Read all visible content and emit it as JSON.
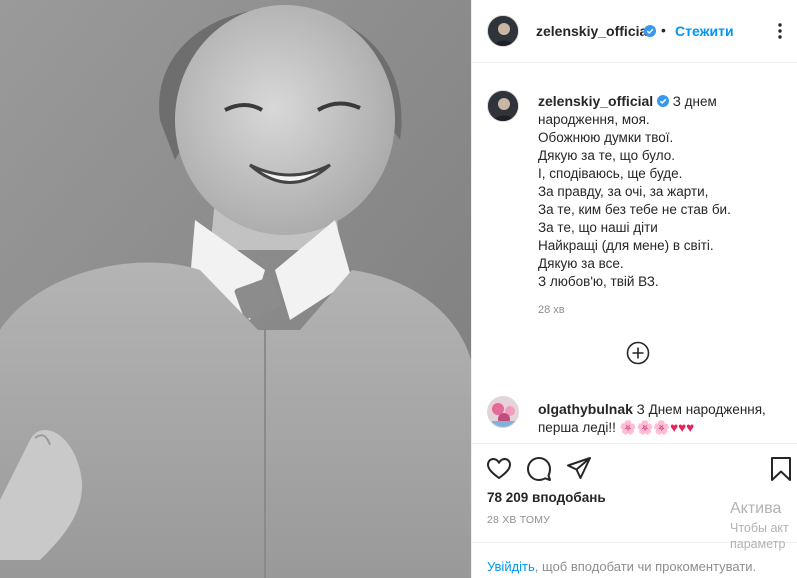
{
  "post": {
    "author": "zelenskiy_official",
    "follow_label": "Стежити",
    "separator": "•",
    "caption_lines": [
      "З днем",
      "народження, моя.",
      "Обожнюю думки твої.",
      "Дякую за те, що було.",
      "І, сподіваюсь, ще буде.",
      "За правду, за очі, за жарти,",
      "За те, ким без тебе не став би.",
      "За те, що наші діти",
      "Найкращі (для мене) в світі.",
      "Дякую за все.",
      "З любов'ю, твій ВЗ."
    ],
    "caption_time": "28 хв",
    "likes": "78 209 вподобань",
    "time_ago": "28 ХВ ТОМУ"
  },
  "comment": {
    "author": "olgathybulnak",
    "text": "З Днем народження, перша леді!!",
    "flowers": "🌸🌸🌸",
    "hearts": "♥♥♥"
  },
  "login_bar": {
    "link": "Увійдіть",
    "rest": ", щоб вподобати чи прокоментувати."
  },
  "watermark": {
    "title": "Актива",
    "line1": "Чтобы акт",
    "line2": "параметр"
  },
  "icons": {
    "verified": "verified-badge-icon",
    "more": "more-options-icon",
    "load_more": "plus-circle-icon",
    "like": "heart-icon",
    "comment": "comment-bubble-icon",
    "share": "paper-plane-icon",
    "save": "bookmark-icon"
  },
  "colors": {
    "accent": "#0095f6",
    "verified": "#3897f0",
    "text": "#262626",
    "muted": "#8e8e8e",
    "heart": "#e0245e"
  }
}
